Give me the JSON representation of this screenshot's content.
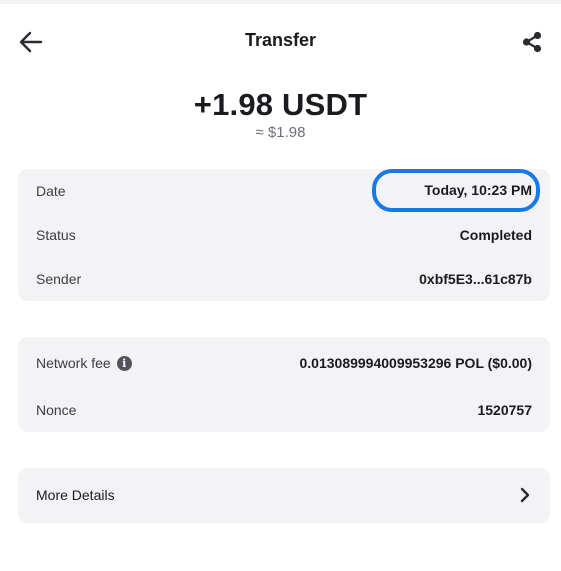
{
  "header": {
    "title": "Transfer",
    "back_icon": "arrow-left-icon",
    "share_icon": "share-icon"
  },
  "transaction": {
    "amount": "+1.98 USDT",
    "fiat_amount": "≈ $1.98"
  },
  "details": {
    "date_label": "Date",
    "date_value": "Today, 10:23 PM",
    "status_label": "Status",
    "status_value": "Completed",
    "sender_label": "Sender",
    "sender_value": "0xbf5E3...61c87b"
  },
  "fees": {
    "network_fee_label": "Network fee",
    "network_fee_value": "0.013089994009953296 POL ($0.00)",
    "info_icon": "info-icon",
    "nonce_label": "Nonce",
    "nonce_value": "1520757"
  },
  "more": {
    "label": "More Details",
    "chevron_icon": "chevron-right-icon"
  },
  "colors": {
    "highlight": "#1778e8",
    "card_background": "#f3f3f5",
    "text_primary": "#1b1b1f",
    "text_secondary": "#6e6e78"
  }
}
